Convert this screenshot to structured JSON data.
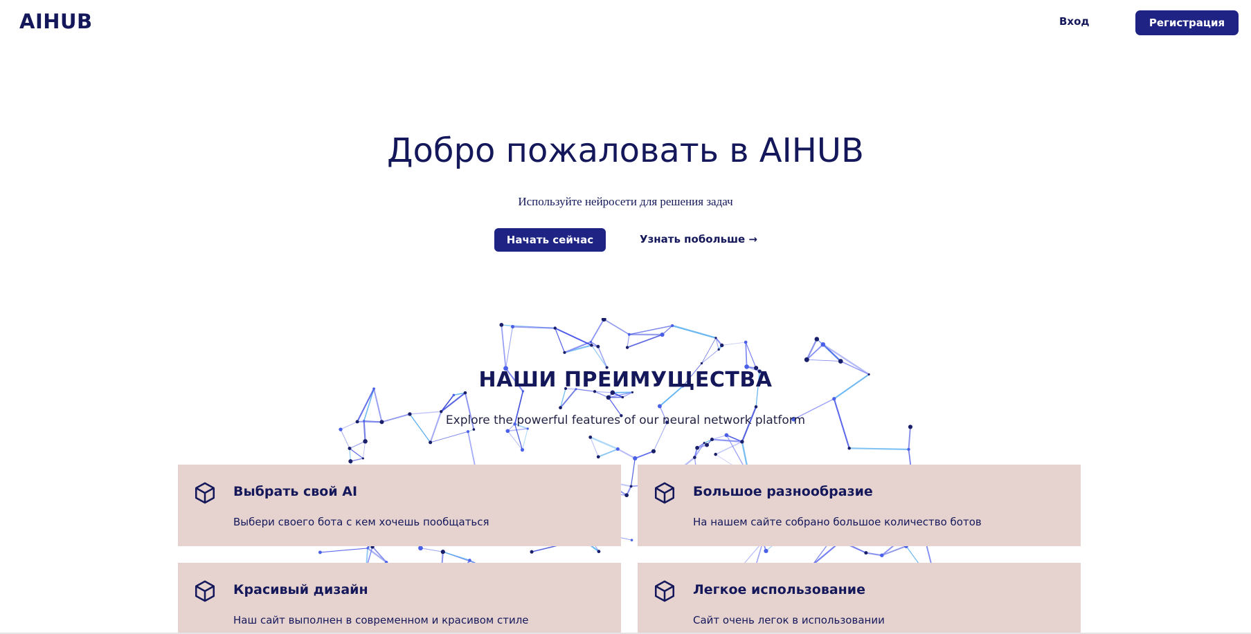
{
  "brand": {
    "logo": "AIHUB",
    "accent": "#1e2384",
    "text_color": "#14185a",
    "card_bg": "#e6d3cf"
  },
  "nav": {
    "login": "Вход",
    "register": "Регистрация"
  },
  "hero": {
    "title": "Добро пожаловать в AIHUB",
    "subtitle": "Используйте нейросети для решения задач",
    "cta_primary": "Начать сейчас",
    "cta_secondary": "Узнать побольше →"
  },
  "features": {
    "title": "НАШИ ПРЕИМУЩЕСТВА",
    "subtitle": "Explore the powerful features of our neural network platform",
    "items": [
      {
        "icon": "cube-icon",
        "title": "Выбрать свой AI",
        "text": "Выбери своего бота с кем хочешь пообщаться"
      },
      {
        "icon": "cube-icon",
        "title": "Большое разнообразие",
        "text": "На нашем сайте собрано большое количество ботов"
      },
      {
        "icon": "cube-icon",
        "title": "Красивый дизайн",
        "text": "Наш сайт выполнен в современном и красивом стиле"
      },
      {
        "icon": "cube-icon",
        "title": "Легкое использование",
        "text": "Сайт очень легок в использовании"
      }
    ]
  }
}
